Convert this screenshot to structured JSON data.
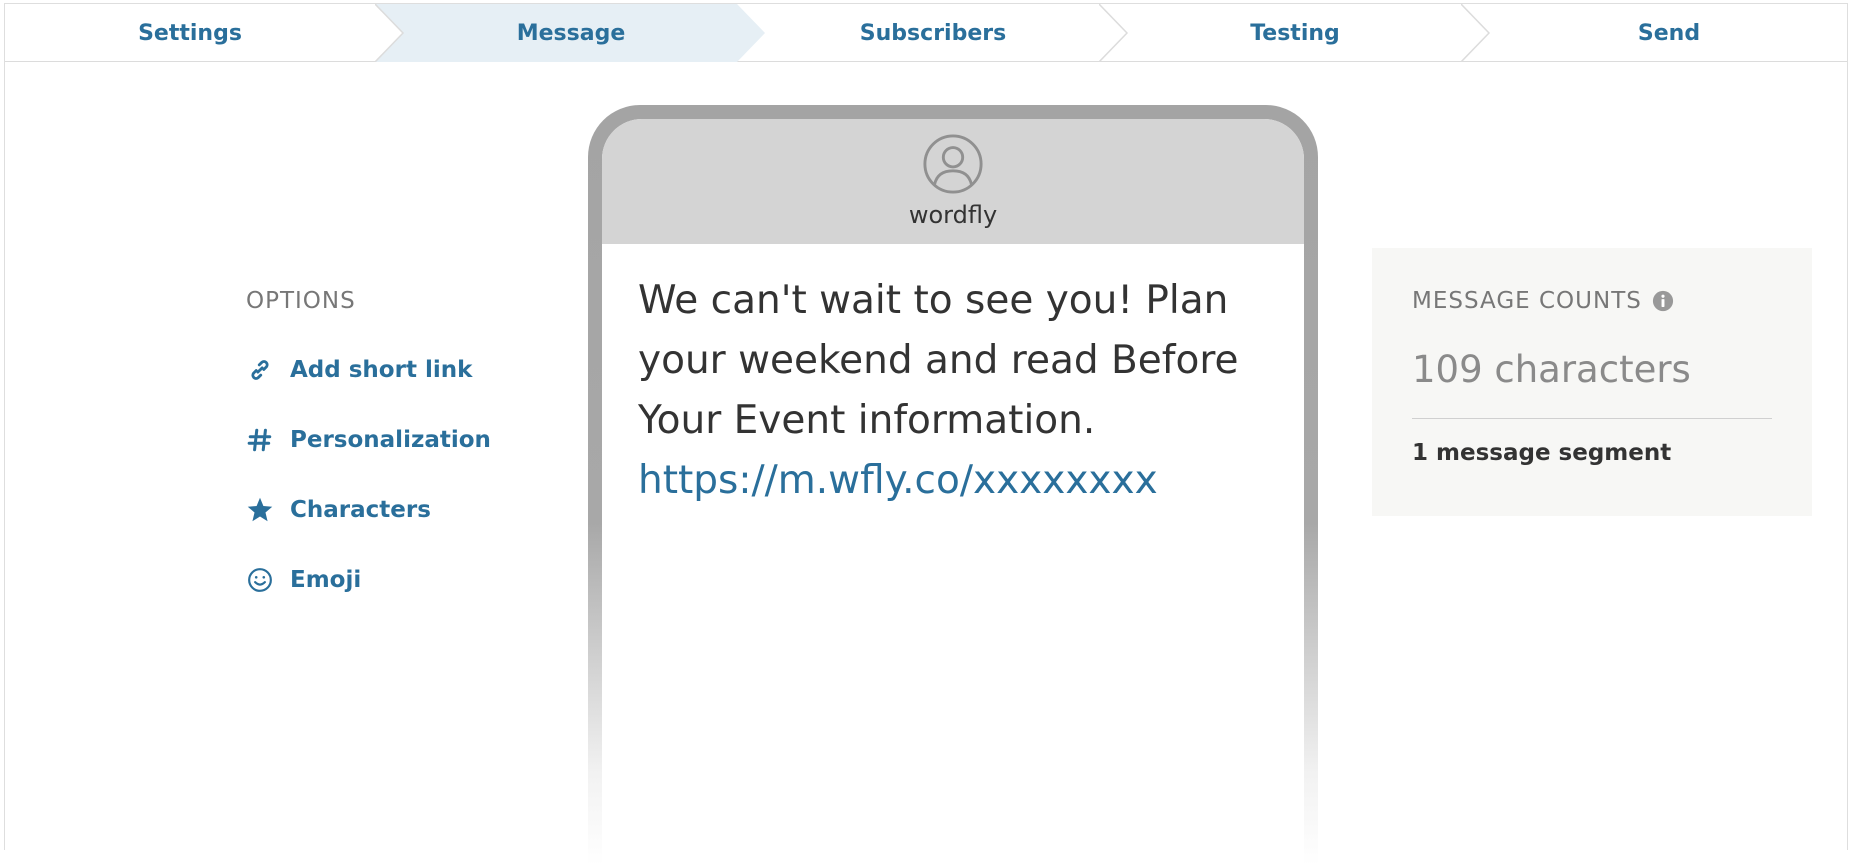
{
  "steps": [
    {
      "label": "Settings",
      "active": false
    },
    {
      "label": "Message",
      "active": true
    },
    {
      "label": "Subscribers",
      "active": false
    },
    {
      "label": "Testing",
      "active": false
    },
    {
      "label": "Send",
      "active": false
    }
  ],
  "options": {
    "title": "OPTIONS",
    "items": [
      {
        "label": "Add short link",
        "icon": "link-icon"
      },
      {
        "label": "Personalization",
        "icon": "hash-icon"
      },
      {
        "label": "Characters",
        "icon": "star-icon"
      },
      {
        "label": "Emoji",
        "icon": "smiley-icon"
      }
    ]
  },
  "phone": {
    "sender": "wordfly",
    "message_text": "We can't wait to see you! Plan your weekend and read Before Your Event information.",
    "message_link": "https://m.wfly.co/xxxxxxxx"
  },
  "counts": {
    "title": "MESSAGE COUNTS",
    "characters": "109 characters",
    "segments": "1 message segment"
  },
  "colors": {
    "accent": "#2a6f9b",
    "active_step_bg": "#e6eff5",
    "panel_bg": "#f7f7f5"
  }
}
